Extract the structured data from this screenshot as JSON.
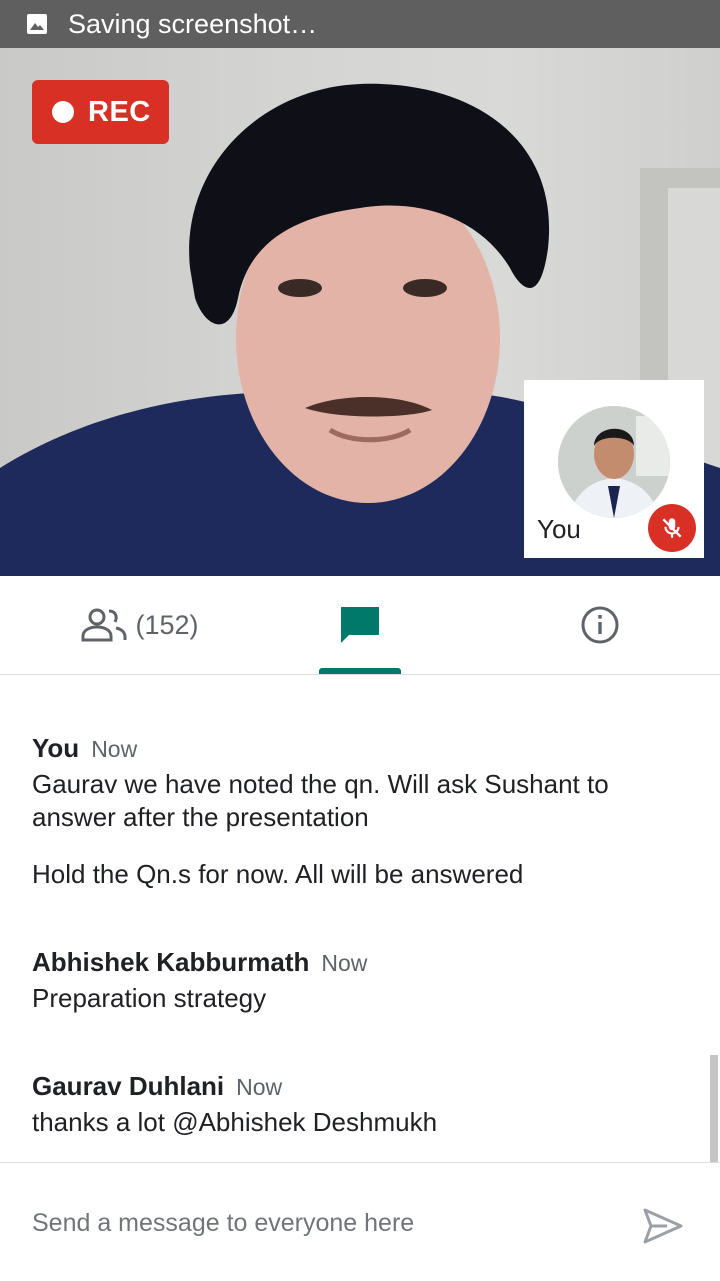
{
  "status_bar": {
    "text": "Saving screenshot…"
  },
  "video": {
    "rec_label": "REC",
    "self_view_label": "You"
  },
  "tabs": {
    "participants_count": "(152)"
  },
  "chat": {
    "messages": [
      {
        "sender": "You",
        "time": "Now",
        "lines": [
          "Gaurav we have noted the qn. Will ask Sushant to answer after the presentation",
          "Hold the Qn.s for now. All will be answered"
        ]
      },
      {
        "sender": "Abhishek Kabburmath",
        "time": "Now",
        "lines": [
          "Preparation strategy"
        ]
      },
      {
        "sender": "Gaurav Duhlani",
        "time": "Now",
        "lines": [
          "thanks a lot @Abhishek Deshmukh"
        ]
      }
    ]
  },
  "composer": {
    "placeholder": "Send a message to everyone here"
  },
  "colors": {
    "accent": "#00796b",
    "rec_red": "#d93025",
    "status_bar": "#5f5f5f"
  }
}
